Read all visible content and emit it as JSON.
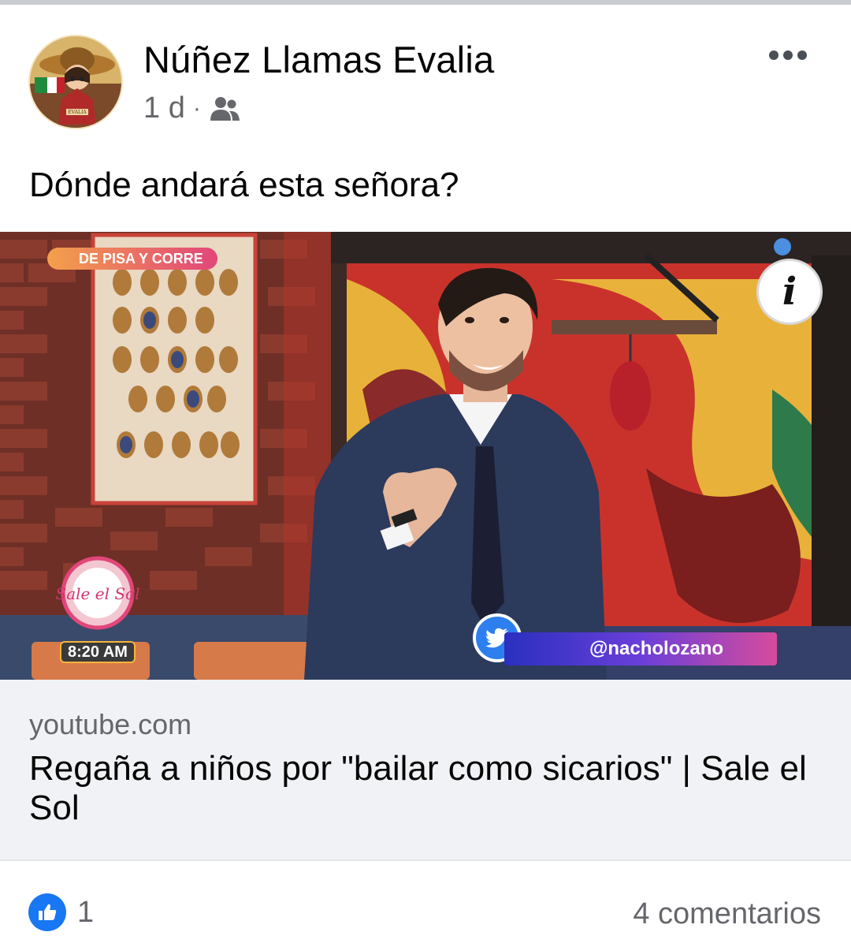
{
  "post": {
    "author": "Núñez Llamas Evalia",
    "avatar_badge_text": "EVALIA",
    "time": "1 d",
    "separator": "·",
    "audience_icon": "friends-icon",
    "more_icon": "more-horizontal-icon",
    "text": "Dónde andará esta señora?"
  },
  "media": {
    "show_tag": "DE PISA Y CORRE",
    "time_badge": "8:20 AM",
    "logo_text": "Sale el Sol",
    "handle": "@nacholozano",
    "info_label": "i",
    "colors": {
      "brick": "#8a3b2e",
      "mural_yellow": "#e8b23a",
      "mural_red": "#c9322b",
      "suit": "#2c3a5c"
    }
  },
  "link": {
    "domain": "youtube.com",
    "title": "Regaña a niños por \"bailar como sicarios\" | Sale el Sol"
  },
  "footer": {
    "reaction_icon": "like-icon",
    "reaction_count": "1",
    "comments": "4 comentarios"
  },
  "colors": {
    "accent": "#1877f2",
    "secondary_text": "#65676b",
    "preview_bg": "#f0f2f5"
  }
}
